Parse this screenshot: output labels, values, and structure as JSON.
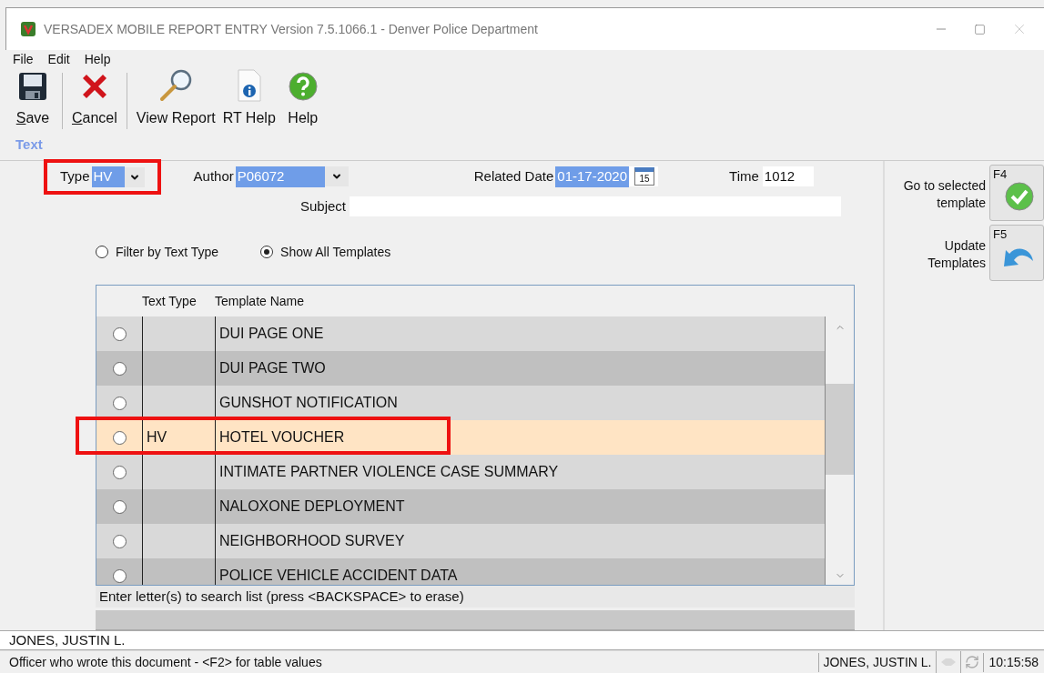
{
  "window": {
    "title": "VERSADEX MOBILE REPORT ENTRY Version 7.5.1066.1 - Denver Police Department"
  },
  "menu": [
    "File",
    "Edit",
    "Help"
  ],
  "toolbar": [
    {
      "kind": "save",
      "label": "Save",
      "underline_first": true
    },
    {
      "kind": "cancel",
      "label": "Cancel",
      "underline_first": true
    },
    {
      "kind": "view",
      "label": "View Report"
    },
    {
      "kind": "info",
      "label": "RT Help"
    },
    {
      "kind": "help",
      "label": "Help"
    }
  ],
  "section_label": "Text",
  "form": {
    "type": {
      "label": "Type",
      "value": "HV",
      "highlighted": true
    },
    "author": {
      "label": "Author",
      "value": "P06072"
    },
    "related_date": {
      "label": "Related Date",
      "value": "01-17-2020",
      "calendar_day": "15"
    },
    "time": {
      "label": "Time",
      "value": "1012"
    },
    "subject": {
      "label": "Subject"
    }
  },
  "filters": [
    {
      "label": "Filter by Text Type",
      "selected": false
    },
    {
      "label": "Show All Templates",
      "selected": true
    }
  ],
  "table": {
    "columns": [
      "Text Type",
      "Template Name"
    ],
    "rows": [
      {
        "text_type": "",
        "name": "DUI PAGE ONE",
        "selected": false,
        "highlighted": false
      },
      {
        "text_type": "",
        "name": "DUI PAGE TWO",
        "selected": false,
        "highlighted": false
      },
      {
        "text_type": "",
        "name": "GUNSHOT NOTIFICATION",
        "selected": false,
        "highlighted": false
      },
      {
        "text_type": "HV",
        "name": "HOTEL VOUCHER",
        "selected": true,
        "highlighted": true
      },
      {
        "text_type": "",
        "name": "INTIMATE PARTNER VIOLENCE CASE SUMMARY",
        "selected": false,
        "highlighted": false
      },
      {
        "text_type": "",
        "name": "NALOXONE DEPLOYMENT",
        "selected": false,
        "highlighted": false
      },
      {
        "text_type": "",
        "name": "NEIGHBORHOOD SURVEY",
        "selected": false,
        "highlighted": false
      },
      {
        "text_type": "",
        "name": "POLICE VEHICLE ACCIDENT DATA",
        "selected": false,
        "highlighted": false
      }
    ],
    "search_hint": "Enter letter(s) to search list (press <BACKSPACE> to erase)"
  },
  "side_buttons": [
    {
      "kind": "go",
      "label": "Go to selected template",
      "key": "F4"
    },
    {
      "kind": "update",
      "label": "Update Templates",
      "key": "F5"
    }
  ],
  "author_line": "JONES, JUSTIN L.",
  "status_bar": {
    "message": "Officer who wrote this document - <F2> for table values",
    "user": "JONES, JUSTIN L.",
    "time": "10:15:58"
  }
}
